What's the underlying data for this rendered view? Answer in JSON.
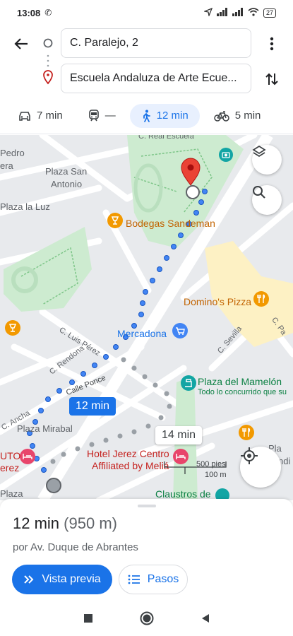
{
  "status": {
    "time": "13:08",
    "battery": "27"
  },
  "header": {
    "origin": "C. Paralejo, 2",
    "destination": "Escuela Andaluza de Arte Ecue..."
  },
  "modes": [
    {
      "name": "car",
      "label": "7 min",
      "active": false
    },
    {
      "name": "transit",
      "label": "—",
      "active": false
    },
    {
      "name": "walk",
      "label": "12 min",
      "active": true
    },
    {
      "name": "bike",
      "label": "5 min",
      "active": false
    }
  ],
  "map": {
    "labels": {
      "real_escuela": "C. Real Escuela",
      "pedro": "Pedro",
      "era": "era",
      "plaza_san_antonio_1": "Plaza San",
      "plaza_san_antonio_2": "Antonio",
      "plaza_la_luz": "Plaza la Luz",
      "bodegas": "Bodegas Sandeman",
      "dominos": "Domino's Pizza",
      "mercadona": "Mercadona",
      "luis_perez": "C. Luis Pérez",
      "rendona": "C. Rendona",
      "calle_ponce": "Calle Ponce",
      "c_sevilla": "C. Sevilla",
      "c_pa": "C. Pa",
      "plaza_mamelon": "Plaza del Mamelón",
      "mamelon_sub": "Todo lo concurrido que su",
      "c_ancha": "C. Ancha",
      "plaza_mirabal": "Plaza Mirabal",
      "uto": "UTO",
      "erez": "erez",
      "hotel_1": "Hotel Jerez Centro",
      "hotel_2": "Affiliated by Meliá",
      "claustros": "Claustros de",
      "pla": "Pla",
      "andi": "ndi",
      "plaza_bottom": "Plaza"
    },
    "primary_route_time": "12 min",
    "alt_route_time": "14 min",
    "scale_ft": "500 pies",
    "scale_m": "100 m"
  },
  "sheet": {
    "duration": "12 min",
    "distance": "(950 m)",
    "via": "por Av. Duque de Abrantes",
    "preview_label": "Vista previa",
    "steps_label": "Pasos"
  },
  "colors": {
    "accent": "#1a73e8",
    "park": "#cdebd0",
    "destination": "#ea4335"
  }
}
